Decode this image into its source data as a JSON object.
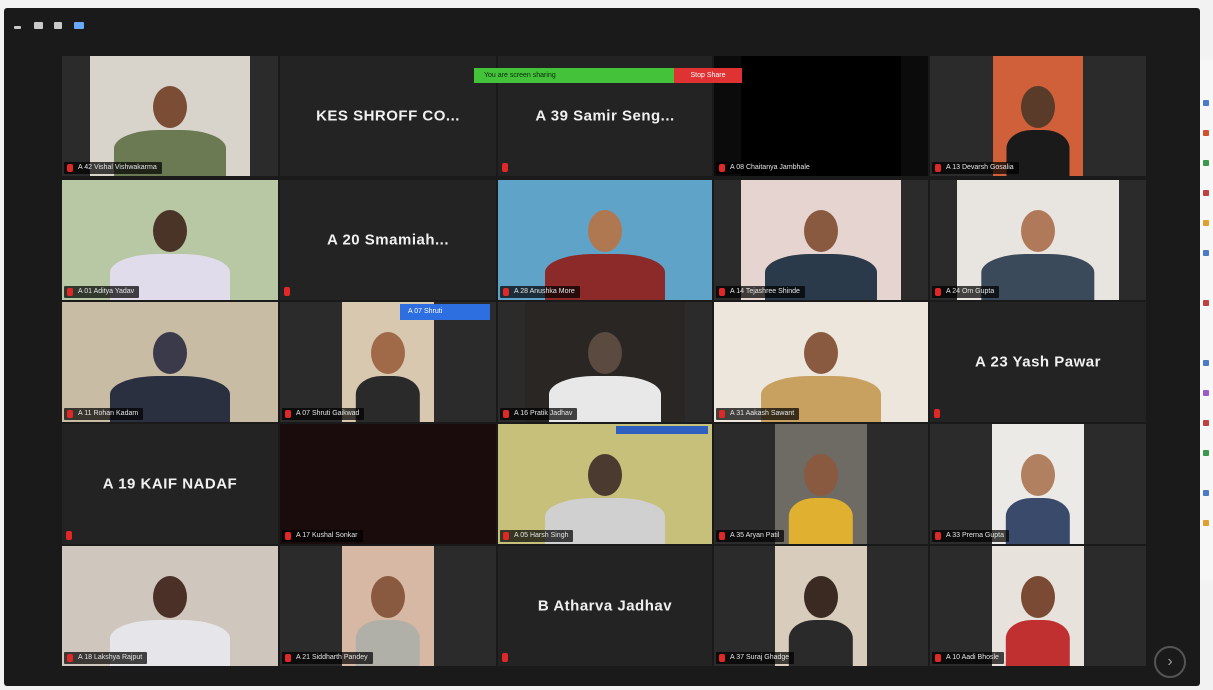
{
  "share_bar": {
    "status_text": "You are screen sharing",
    "stop_label": "Stop Share"
  },
  "tiles": [
    {
      "id": "r1c1",
      "kind": "video",
      "label": "A 42 Vishal Vishwakarma",
      "muted": true,
      "scene": {
        "bg": "#d8d4cc",
        "skin": "#7a4d34",
        "shirt": "#6b7a52"
      }
    },
    {
      "id": "r1c2",
      "kind": "name",
      "name": "KES SHROFF CO...",
      "muted": false
    },
    {
      "id": "r1c3",
      "kind": "name",
      "name": "A 39 Samir Seng...",
      "muted": true
    },
    {
      "id": "r1c4",
      "kind": "black",
      "label": "A 08 Chaitanya Jambhale",
      "muted": true
    },
    {
      "id": "r1c5",
      "kind": "video",
      "label": "A 13 Devarsh Gosalia",
      "muted": true,
      "scene": {
        "bg": "#d0603a",
        "skin": "#5a3a28",
        "shirt": "#1a1a1a"
      }
    },
    {
      "id": "r2c1",
      "kind": "video",
      "label": "A 01 Aditya Yadav",
      "muted": true,
      "scene": {
        "bg": "#b8c8a4",
        "skin": "#4a3428",
        "shirt": "#e0dcec"
      }
    },
    {
      "id": "r2c2",
      "kind": "name",
      "name": "A 20 Smamiah...",
      "muted": true
    },
    {
      "id": "r2c3",
      "kind": "video",
      "label": "A 28 Anushka More",
      "muted": true,
      "scene": {
        "bg": "#5fa3c9",
        "skin": "#b07850",
        "shirt": "#8c2a2a"
      }
    },
    {
      "id": "r2c4",
      "kind": "video",
      "label": "A 14 Tejashree Shinde",
      "muted": true,
      "scene": {
        "bg": "#e6d4d0",
        "skin": "#8a5a40",
        "shirt": "#2a3a4a"
      }
    },
    {
      "id": "r2c5",
      "kind": "video",
      "label": "A 24 Om Gupta",
      "muted": true,
      "scene": {
        "bg": "#e8e4e0",
        "skin": "#b07a5a",
        "shirt": "#3a4a5a"
      }
    },
    {
      "id": "r3c1",
      "kind": "video",
      "label": "A 11 Rohan Kadam",
      "muted": true,
      "active": true,
      "scene": {
        "bg": "#c8bca4",
        "skin": "#3a3a4a",
        "shirt": "#2a3040"
      }
    },
    {
      "id": "r3c2",
      "kind": "video",
      "label": "A 07 Shruti Gaikwad",
      "muted": true,
      "scene": {
        "bg": "#d8c8b0",
        "skin": "#a06a48",
        "shirt": "#2a2a2a"
      }
    },
    {
      "id": "r3c3",
      "kind": "video",
      "label": "A 16 Pratik Jadhav",
      "muted": true,
      "scene": {
        "bg": "#2a2624",
        "skin": "#5a4a40",
        "shirt": "#e8e8e8"
      }
    },
    {
      "id": "r3c4",
      "kind": "video",
      "label": "A 31 Aakash Sawant",
      "muted": true,
      "scene": {
        "bg": "#ece6dc",
        "skin": "#8a5a40",
        "shirt": "#c8a060"
      }
    },
    {
      "id": "r3c5",
      "kind": "name",
      "name": "A 23 Yash Pawar",
      "muted": true
    },
    {
      "id": "r4c1",
      "kind": "name",
      "name": "A 19 KAIF NADAF",
      "muted": true
    },
    {
      "id": "r4c2",
      "kind": "dark",
      "label": "A 17 Kushal Sonkar",
      "muted": true
    },
    {
      "id": "r4c3",
      "kind": "video",
      "label": "A 05 Harsh Singh",
      "muted": true,
      "scene": {
        "bg": "#c6c07a",
        "skin": "#4a3a30",
        "shirt": "#d0d0d0"
      }
    },
    {
      "id": "r4c4",
      "kind": "video",
      "label": "A 35 Aryan Patil",
      "muted": true,
      "scene": {
        "bg": "#6e6a64",
        "skin": "#8a5a40",
        "shirt": "#e0b030"
      }
    },
    {
      "id": "r4c5",
      "kind": "video",
      "label": "A 33 Prerna Gupta",
      "muted": true,
      "scene": {
        "bg": "#eceae6",
        "skin": "#b08060",
        "shirt": "#3a4a6a"
      }
    },
    {
      "id": "r5c1",
      "kind": "video",
      "label": "A 18 Lakshya Rajput",
      "muted": true,
      "scene": {
        "bg": "#cfc7bd",
        "skin": "#4a3026",
        "shirt": "#e6e6ea"
      }
    },
    {
      "id": "r5c2",
      "kind": "video",
      "label": "A 21 Siddharth Pandey",
      "muted": true,
      "scene": {
        "bg": "#d6b8a4",
        "skin": "#8a5a40",
        "shirt": "#b0b0a8"
      }
    },
    {
      "id": "r5c3",
      "kind": "name",
      "name": "B Atharva Jadhav",
      "muted": true
    },
    {
      "id": "r5c4",
      "kind": "video",
      "label": "A 37 Suraj Ghadge",
      "muted": true,
      "scene": {
        "bg": "#d8ccbc",
        "skin": "#3a2a22",
        "shirt": "#2a2a2a"
      }
    },
    {
      "id": "r5c5",
      "kind": "video",
      "label": "A 10 Aadi Bhosle",
      "muted": true,
      "scene": {
        "bg": "#e8e2dc",
        "skin": "#7a4a34",
        "shirt": "#c03030"
      }
    }
  ],
  "pinned_tag": "A 07 Shruti",
  "colors": {
    "mic_muted": "#e02828",
    "share_green": "#43c23a",
    "share_red": "#e03232",
    "active_speaker": "#d7e04a"
  }
}
